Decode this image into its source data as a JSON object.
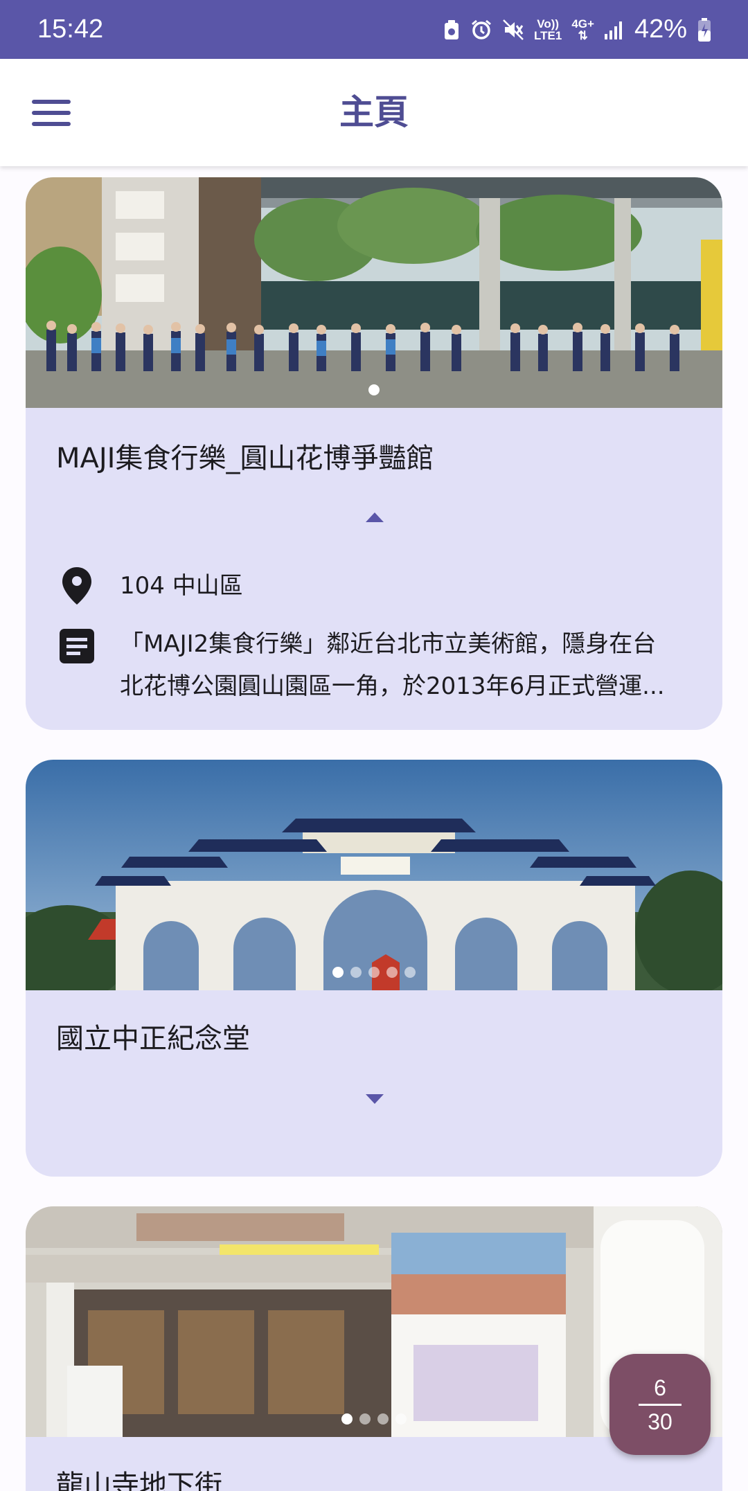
{
  "status_bar": {
    "time": "15:42",
    "volte": "Vo))",
    "lte": "LTE1",
    "network": "4G+",
    "battery": "42%",
    "icons": [
      "recycle-icon",
      "alarm-icon",
      "mute-icon",
      "signal-icon",
      "battery-charging-icon"
    ]
  },
  "app_bar": {
    "title": "主頁",
    "menu_icon": "hamburger-menu-icon"
  },
  "cards": [
    {
      "title": "MAJI集食行樂_圓山花博爭豔館",
      "expanded": true,
      "address": "104 中山區",
      "description": "「MAJI2集食行樂」鄰近台北市立美術館，隱身在台北花博公園圓山園區一角，於2013年6月正式營運...",
      "image_count": 1,
      "image_index": 1
    },
    {
      "title": "國立中正紀念堂",
      "expanded": false,
      "image_count": 5,
      "image_index": 1
    },
    {
      "title": "龍山寺地下街",
      "expanded": false,
      "image_count": 4,
      "image_index": 1
    }
  ],
  "pager": {
    "current": "6",
    "total": "30"
  },
  "colors": {
    "primary": "#5a56a8",
    "title": "#4f4d93",
    "card_bg": "#e1e0f7",
    "fab": "#7d4e66"
  }
}
